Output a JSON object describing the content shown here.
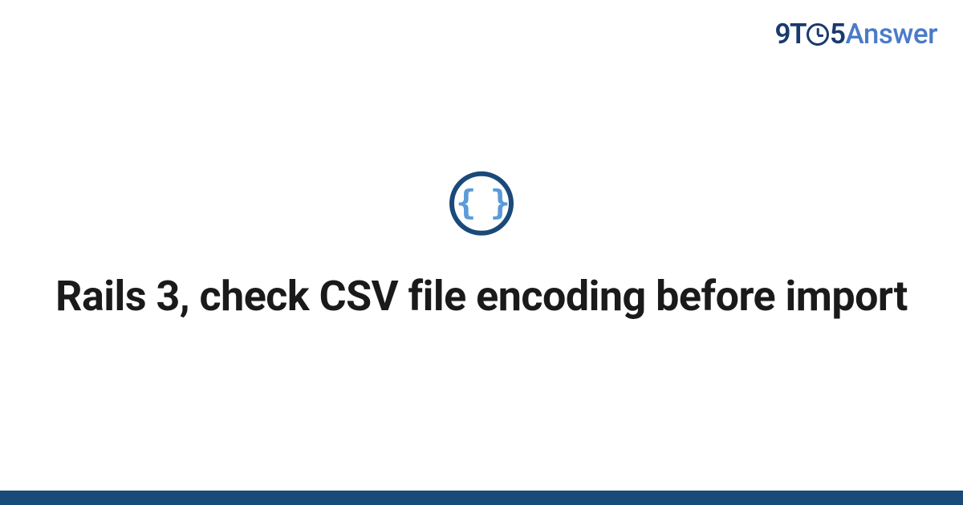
{
  "brand": {
    "part1": "9",
    "part2": "T",
    "part3": "5",
    "part4": "Answer"
  },
  "icon": {
    "name": "code-braces",
    "glyph": "{ }"
  },
  "title": "Rails 3, check CSV file encoding before import",
  "colors": {
    "brand_dark": "#1a3a6e",
    "brand_accent": "#4a7bc8",
    "icon_ring": "#1a4a7a",
    "icon_braces": "#5a9bd8",
    "bottom_bar": "#1a4a7a",
    "title_text": "#1a1a1a"
  }
}
